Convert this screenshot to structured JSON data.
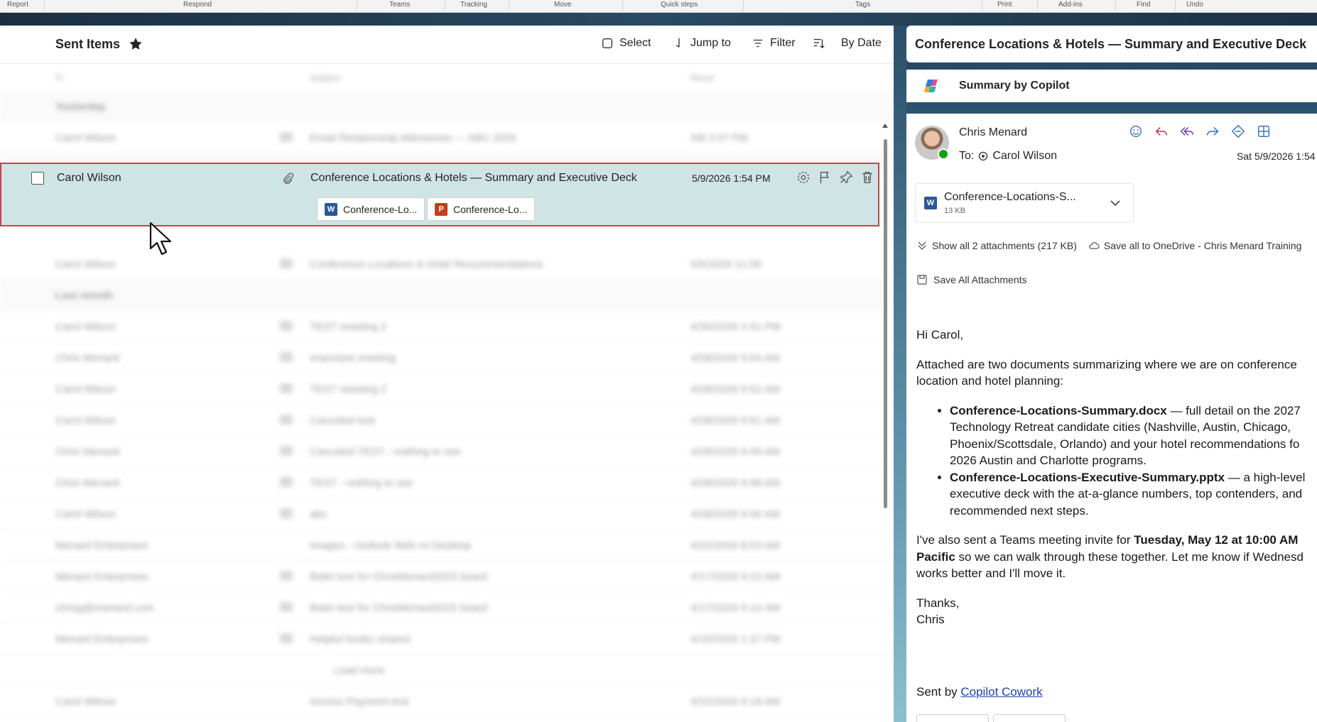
{
  "ribbon": {
    "groups": [
      "Report",
      "Respond",
      "Teams",
      "Tracking",
      "Move",
      "Quick steps",
      "Tags",
      "Print",
      "Add-ins",
      "Find",
      "Undo"
    ]
  },
  "list": {
    "folder_title": "Sent Items",
    "toolbar": {
      "select": "Select",
      "jump_to": "Jump to",
      "filter": "Filter",
      "by_date": "By Date"
    },
    "selected_message": {
      "sender": "Carol Wilson",
      "subject": "Conference Locations & Hotels — Summary and Executive Deck",
      "date": "5/9/2026 1:54 PM",
      "attachments": [
        "Conference-Lo...",
        "Conference-Lo..."
      ]
    }
  },
  "reading": {
    "title": "Conference Locations & Hotels — Summary and Executive Deck",
    "copilot_label": "Summary by Copilot",
    "from": "Chris Menard",
    "to_prefix": "To:",
    "to": "Carol Wilson",
    "date": "Sat 5/9/2026 1:54",
    "attachment": {
      "name": "Conference-Locations-S...",
      "size": "13 KB"
    },
    "show_all": "Show all 2 attachments (217 KB)",
    "save_onedrive": "Save all to OneDrive - Chris Menard Training",
    "save_all": "Save All Attachments",
    "body": {
      "greeting": "Hi Carol,",
      "intro": "Attached are two documents summarizing where we are on conference location and hotel planning:",
      "item1_bold": "Conference-Locations-Summary.docx",
      "item1_text": " — full detail on the 2027 Technology Retreat candidate cities (Nashville, Austin, Chicago, Phoenix/Scottsdale, Orlando) and your hotel recommendations fo 2026 Austin and Charlotte programs.",
      "item2_bold": "Conference-Locations-Executive-Summary.pptx",
      "item2_text": " — a high-level executive deck with the at-a-glance numbers, top contenders, and recommended next steps.",
      "p3_start": "I've also sent a Teams meeting invite for ",
      "p3_bold": "Tuesday, May 12 at 10:00 AM Pacific",
      "p3_end": " so we can walk through these together. Let me know if Wednesd works better and I'll move it.",
      "thanks": "Thanks,",
      "signature": "Chris",
      "sent_by_prefix": "Sent by ",
      "sent_by_link": "Copilot Cowork"
    }
  },
  "colors": {
    "selection": "#cfe4e4",
    "selection_border": "#c8434f",
    "word_blue": "#2b579a",
    "ppt_red": "#c43e1c",
    "link": "#1f3fb0",
    "presence": "#13a10e"
  }
}
